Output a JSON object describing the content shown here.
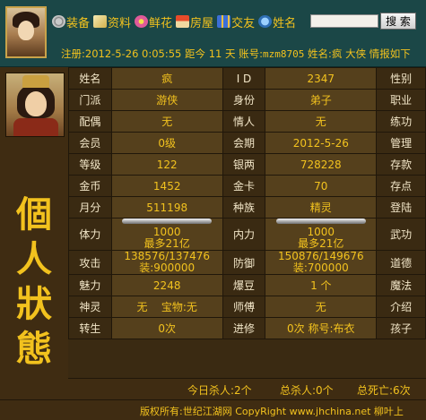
{
  "header": {
    "nav": [
      {
        "label": "装备",
        "icon": "gear-icon"
      },
      {
        "label": "资料",
        "icon": "document-icon"
      },
      {
        "label": "鲜花",
        "icon": "flower-icon"
      },
      {
        "label": "房屋",
        "icon": "house-icon"
      },
      {
        "label": "交友",
        "icon": "gift-icon"
      },
      {
        "label": "姓名",
        "icon": "globe-icon"
      }
    ],
    "search_value": "",
    "search_button": "搜 索",
    "status": {
      "register_prefix": "注册:",
      "register_date": "2012-5-26 0:05:55",
      "days_prefix": "距今",
      "days": "11",
      "days_suffix": "天",
      "account_prefix": "账号:",
      "account": "mzm8705",
      "name_prefix": "姓名:",
      "name": "疯",
      "nickname": "大侠",
      "tail": "情报如下"
    }
  },
  "page_title": "個人狀態",
  "stats": {
    "r1": {
      "l1": "姓名",
      "v1": "疯",
      "l2": "I D",
      "v2": "2347",
      "l3": "性别"
    },
    "r2": {
      "l1": "门派",
      "v1": "游侠",
      "l2": "身份",
      "v2": "弟子",
      "l3": "职业"
    },
    "r3": {
      "l1": "配偶",
      "v1": "无",
      "l2": "情人",
      "v2": "无",
      "l3": "练功"
    },
    "r4": {
      "l1": "会员",
      "v1": "0级",
      "l2": "会期",
      "v2": "2012-5-26",
      "l3": "管理"
    },
    "r5": {
      "l1": "等级",
      "v1": "122",
      "l2": "银两",
      "v2": "728228",
      "l3": "存款"
    },
    "r6": {
      "l1": "金币",
      "v1": "1452",
      "l2": "金卡",
      "v2": "70",
      "l3": "存点"
    },
    "r7": {
      "l1": "月分",
      "v1": "511198",
      "l2": "种族",
      "v2": "精灵",
      "l3": "登陆"
    },
    "r8": {
      "l1": "体力",
      "v1a": "1000",
      "v1b": "最多21亿",
      "l2": "内力",
      "v2a": "1000",
      "v2b": "最多21亿",
      "l3": "武功"
    },
    "r9": {
      "l1": "攻击",
      "v1a": "138576/137476",
      "v1b": "装:900000",
      "l2": "防御",
      "v2a": "150876/149676",
      "v2b": "装:700000",
      "l3": "道德"
    },
    "r10": {
      "l1": "魅力",
      "v1": "2248",
      "l2": "爆豆",
      "v2": "1 个",
      "l3": "魔法"
    },
    "r11": {
      "l1": "神灵",
      "v1a": "无",
      "v1b": "宝物:无",
      "l2": "师傅",
      "v2": "无",
      "l3": "介绍"
    },
    "r12": {
      "l1": "转生",
      "v1": "0次",
      "l2": "进修",
      "v2a": "0次",
      "v2b": "称号:布衣",
      "l3": "孩子"
    }
  },
  "footer": {
    "today_kills": "今日杀人:2个",
    "total_kills": "总杀人:0个",
    "total_deaths": "总死亡:6次",
    "copyright": "版权所有:世纪江湖网 CopyRight www.jhchina.net 柳叶上"
  },
  "colors": {
    "gold": "#f2c21e",
    "header_bg": "#1b4747",
    "panel_bg": "#3a2a12",
    "cell_bg": "#55401c"
  }
}
